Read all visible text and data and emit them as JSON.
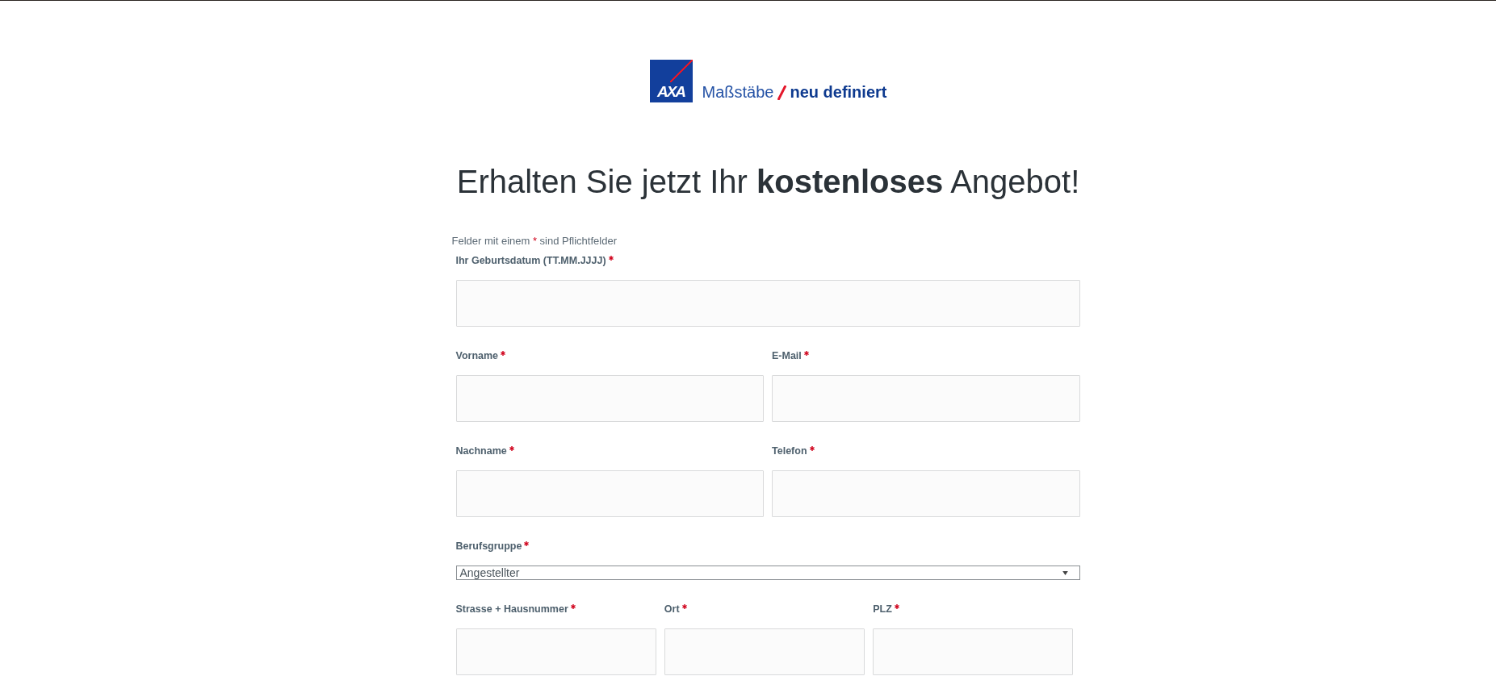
{
  "logo": {
    "mark": "AXA",
    "tagline": "Maßstäbe",
    "tagline_bold": "neu definiert"
  },
  "heading": "Erhalten Sie jetzt Ihr **kostenloses** Angebot!",
  "form": {
    "note": {
      "before": "Felder mit einem",
      "mark": "*",
      "after": "sind Pflichtfelder"
    },
    "rows": [
      [
        {
          "kind": "text",
          "label": "Ihr Geburtsdatum (TT.MM.JJJJ)",
          "required": true
        }
      ],
      [
        {
          "kind": "text",
          "label": "Vorname",
          "required": true
        },
        {
          "kind": "text",
          "label": "E-Mail",
          "required": true
        }
      ],
      [
        {
          "kind": "text",
          "label": "Nachname",
          "required": true
        },
        {
          "kind": "text",
          "label": "Telefon",
          "required": true
        }
      ],
      [
        {
          "kind": "select",
          "label": "Berufsgruppe",
          "required": true,
          "value": "Angestellter"
        }
      ],
      [
        {
          "kind": "text",
          "label": "Strasse + Hausnummer",
          "required": true
        },
        {
          "kind": "text",
          "label": "Ort",
          "required": true
        },
        {
          "kind": "text",
          "label": "PLZ",
          "required": true
        }
      ]
    ]
  }
}
